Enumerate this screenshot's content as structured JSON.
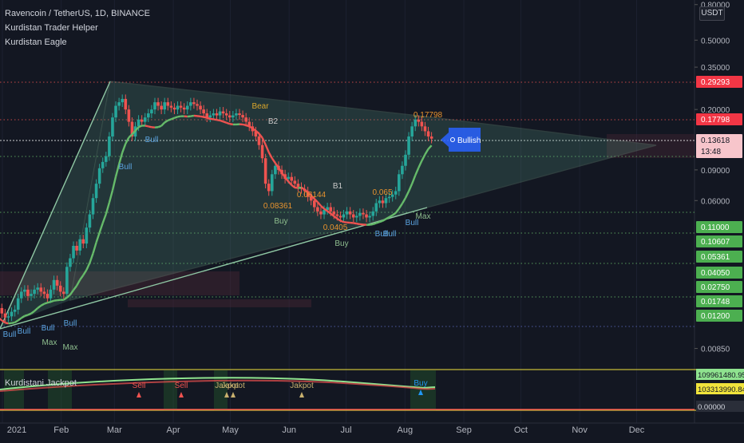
{
  "header": {
    "symbol_line": "Ravencoin / TetherUS, 1D, BINANCE",
    "indicator_1": "Kurdistan Trader Helper",
    "indicator_2": "Kurdistan Eagle",
    "currency_button": "USDT"
  },
  "sub_panel": {
    "title": "Kurdistani Jackpot"
  },
  "chart_data": [
    {
      "type": "candlestick",
      "title": "Ravencoin / TetherUS, 1D, BINANCE",
      "x_axis": {
        "tick_labels": [
          "2021",
          "Feb",
          "Mar",
          "Apr",
          "May",
          "Jun",
          "Jul",
          "Aug",
          "Sep",
          "Oct",
          "Nov",
          "Dec"
        ]
      },
      "y_axis": {
        "scale": "log",
        "tick_labels": [
          "0.80000",
          "0.50000",
          "0.35000",
          "0.20000",
          "0.09000",
          "0.06000",
          "0.00850"
        ],
        "range": [
          0.0065,
          0.85
        ]
      },
      "price_labels": [
        {
          "text": "0.29293",
          "color": "#f23645"
        },
        {
          "text": "0.17798",
          "color": "#f23645"
        },
        {
          "text": "0.13618",
          "sub": "13:48",
          "color": "#f7c5cb",
          "text_color": "#131722"
        },
        {
          "text": "0.11000",
          "color": "#4caf50"
        },
        {
          "text": "0.10607",
          "color": "#4caf50"
        },
        {
          "text": "0.05361",
          "color": "#4caf50"
        },
        {
          "text": "0.04050",
          "color": "#4caf50"
        },
        {
          "text": "0.02750",
          "color": "#4caf50"
        },
        {
          "text": "0.01748",
          "color": "#4caf50"
        },
        {
          "text": "0.01200",
          "color": "#4caf50"
        }
      ],
      "price_close": [
        0.0145,
        0.0135,
        0.0128,
        0.013,
        0.0138,
        0.0142,
        0.0165,
        0.018,
        0.0185,
        0.017,
        0.0175,
        0.0185,
        0.019,
        0.018,
        0.0175,
        0.0165,
        0.0185,
        0.021,
        0.0195,
        0.018,
        0.0175,
        0.025,
        0.028,
        0.033,
        0.031,
        0.036,
        0.034,
        0.042,
        0.05,
        0.062,
        0.075,
        0.092,
        0.1,
        0.108,
        0.14,
        0.18,
        0.21,
        0.22,
        0.23,
        0.2,
        0.17,
        0.14,
        0.16,
        0.175,
        0.17,
        0.18,
        0.19,
        0.2,
        0.22,
        0.21,
        0.2,
        0.22,
        0.21,
        0.205,
        0.2,
        0.21,
        0.205,
        0.2,
        0.21,
        0.22,
        0.215,
        0.21,
        0.2,
        0.19,
        0.18,
        0.185,
        0.19,
        0.185,
        0.195,
        0.19,
        0.185,
        0.18,
        0.185,
        0.19,
        0.186,
        0.18,
        0.17,
        0.16,
        0.15,
        0.14,
        0.125,
        0.105,
        0.075,
        0.068,
        0.085,
        0.095,
        0.09,
        0.085,
        0.08,
        0.082,
        0.078,
        0.075,
        0.072,
        0.07,
        0.068,
        0.063,
        0.06,
        0.055,
        0.052,
        0.05,
        0.053,
        0.055,
        0.052,
        0.05,
        0.049,
        0.048,
        0.05,
        0.052,
        0.05,
        0.048,
        0.049,
        0.051,
        0.05,
        0.048,
        0.049,
        0.052,
        0.058,
        0.06,
        0.058,
        0.062,
        0.063,
        0.065,
        0.068,
        0.085,
        0.095,
        0.11,
        0.14,
        0.16,
        0.175,
        0.17,
        0.16,
        0.15,
        0.14,
        0.136
      ],
      "annotations": [
        {
          "text": "Bull",
          "color": "#5ba3e0"
        },
        {
          "text": "Bull",
          "color": "#5ba3e0"
        },
        {
          "text": "Bull",
          "color": "#5ba3e0"
        },
        {
          "text": "Bull",
          "color": "#5ba3e0"
        },
        {
          "text": "Max",
          "color": "#8fbf8f"
        },
        {
          "text": "Max",
          "color": "#8fbf8f"
        },
        {
          "text": "Bull",
          "color": "#5ba3e0"
        },
        {
          "text": "Bull",
          "color": "#5ba3e0"
        },
        {
          "text": "Bear",
          "color": "#d9a52b"
        },
        {
          "text": "B2",
          "color": "#c8c8c8"
        },
        {
          "text": "B1",
          "color": "#c8c8c8"
        },
        {
          "text": "0.08361",
          "color": "#e8932e"
        },
        {
          "text": "0.06144",
          "color": "#e8932e"
        },
        {
          "text": "Buy",
          "color": "#8fbf8f"
        },
        {
          "text": "0.0405",
          "color": "#e8932e"
        },
        {
          "text": "Buy",
          "color": "#8fbf8f"
        },
        {
          "text": "0.065",
          "color": "#e8932e"
        },
        {
          "text": "Bull",
          "color": "#5ba3e0"
        },
        {
          "text": "Bull",
          "color": "#5ba3e0"
        },
        {
          "text": "Bull",
          "color": "#5ba3e0"
        },
        {
          "text": "Max",
          "color": "#8fbf8f"
        },
        {
          "text": "0.17798",
          "color": "#e8932e"
        },
        {
          "text": "Bullish",
          "color": "#ffffff"
        }
      ]
    },
    {
      "type": "line",
      "title": "Kurdistani Jackpot",
      "price_labels": [
        {
          "text": "109961480.95121",
          "color": "#8fe38f"
        },
        {
          "text": "103313990.84178",
          "color": "#f0e33c"
        },
        {
          "text": "0.00000",
          "color": "#2a2e39"
        }
      ],
      "markers": [
        {
          "text": "Sell",
          "color": "#ef5350"
        },
        {
          "text": "Sell",
          "color": "#ef5350"
        },
        {
          "text": "Jakpot",
          "color": "#c8b06e"
        },
        {
          "text": "Jakpot",
          "color": "#c8b06e"
        },
        {
          "text": "Jakpot",
          "color": "#c8b06e"
        },
        {
          "text": "Buy",
          "color": "#2196f3"
        }
      ]
    }
  ],
  "colors": {
    "background": "#131722",
    "bull": "#26a69a",
    "bear": "#ef5350",
    "triangle": "#7fbf9a",
    "ma_green": "#66bb6a",
    "ma_red": "#ef5350"
  }
}
